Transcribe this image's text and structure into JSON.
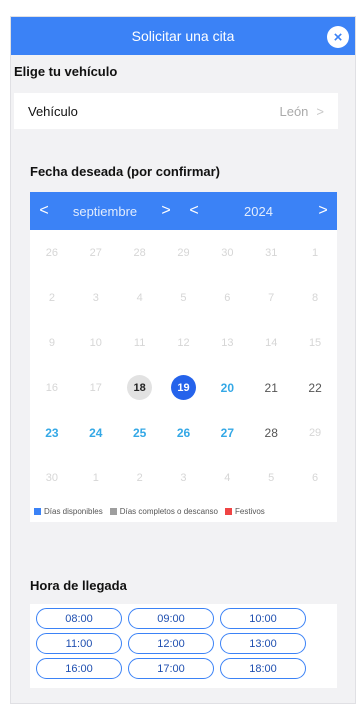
{
  "header": {
    "title": "Solicitar una cita",
    "close_icon": "close-icon"
  },
  "vehicle": {
    "section_title": "Elige tu vehículo",
    "label": "Vehículo",
    "value": "León",
    "chevron": ">"
  },
  "date": {
    "section_title": "Fecha deseada (por confirmar)"
  },
  "calendar": {
    "month": "septiembre",
    "year": "2024",
    "prev": "<",
    "next": ">",
    "colors": {
      "header": "#3b82f6",
      "available": "#34a8e6",
      "selected": "#2563eb",
      "full": "#9e9e9e",
      "holiday": "#ef4444"
    },
    "weeks": [
      [
        {
          "d": "26",
          "s": "muted"
        },
        {
          "d": "27",
          "s": "muted"
        },
        {
          "d": "28",
          "s": "muted"
        },
        {
          "d": "29",
          "s": "muted"
        },
        {
          "d": "30",
          "s": "muted"
        },
        {
          "d": "31",
          "s": "muted"
        },
        {
          "d": "1",
          "s": "muted"
        }
      ],
      [
        {
          "d": "2",
          "s": "muted"
        },
        {
          "d": "3",
          "s": "muted"
        },
        {
          "d": "4",
          "s": "muted"
        },
        {
          "d": "5",
          "s": "muted"
        },
        {
          "d": "6",
          "s": "muted"
        },
        {
          "d": "7",
          "s": "muted"
        },
        {
          "d": "8",
          "s": "muted"
        }
      ],
      [
        {
          "d": "9",
          "s": "muted"
        },
        {
          "d": "10",
          "s": "muted"
        },
        {
          "d": "11",
          "s": "muted"
        },
        {
          "d": "12",
          "s": "muted"
        },
        {
          "d": "13",
          "s": "muted"
        },
        {
          "d": "14",
          "s": "muted"
        },
        {
          "d": "15",
          "s": "muted"
        }
      ],
      [
        {
          "d": "16",
          "s": "muted"
        },
        {
          "d": "17",
          "s": "muted"
        },
        {
          "d": "18",
          "s": "today"
        },
        {
          "d": "19",
          "s": "selected"
        },
        {
          "d": "20",
          "s": "avail"
        },
        {
          "d": "21",
          "s": "full"
        },
        {
          "d": "22",
          "s": "full"
        }
      ],
      [
        {
          "d": "23",
          "s": "avail"
        },
        {
          "d": "24",
          "s": "avail"
        },
        {
          "d": "25",
          "s": "avail"
        },
        {
          "d": "26",
          "s": "avail"
        },
        {
          "d": "27",
          "s": "avail"
        },
        {
          "d": "28",
          "s": "full"
        },
        {
          "d": "29",
          "s": "muted"
        }
      ],
      [
        {
          "d": "30",
          "s": "muted"
        },
        {
          "d": "1",
          "s": "muted"
        },
        {
          "d": "2",
          "s": "muted"
        },
        {
          "d": "3",
          "s": "muted"
        },
        {
          "d": "4",
          "s": "muted"
        },
        {
          "d": "5",
          "s": "muted"
        },
        {
          "d": "6",
          "s": "muted"
        }
      ]
    ],
    "legend": [
      {
        "label": "Días disponibles",
        "color": "#3b82f6"
      },
      {
        "label": "Días completos o descanso",
        "color": "#9e9e9e"
      },
      {
        "label": "Festivos",
        "color": "#ef4444"
      }
    ]
  },
  "arrival": {
    "section_title": "Hora de llegada",
    "times": [
      "08:00",
      "09:00",
      "10:00",
      "11:00",
      "12:00",
      "13:00",
      "16:00",
      "17:00",
      "18:00"
    ]
  }
}
